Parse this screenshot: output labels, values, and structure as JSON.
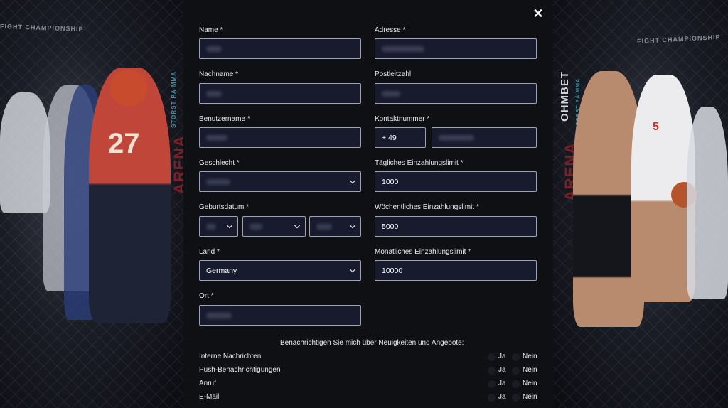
{
  "background": {
    "left_banner": "FIGHT CHAMPIONSHIP",
    "left_vertical_1": "ARENA",
    "left_vertical_2": "STORST PÅ MMA",
    "right_banner": "FIGHT CHAMPIONSHIP",
    "right_brand": "OHMBET",
    "right_vertical_1": "ARENA",
    "right_vertical_2": "STORST PÅ MMA",
    "jersey_left": "27",
    "jersey_right": "5"
  },
  "form": {
    "name": {
      "label": "Name *",
      "value": ""
    },
    "nachname": {
      "label": "Nachname *",
      "value": ""
    },
    "benutzername": {
      "label": "Benutzername *",
      "value": ""
    },
    "geschlecht": {
      "label": "Geschlecht *",
      "value": ""
    },
    "geburtsdatum": {
      "label": "Geburtsdatum *",
      "day": "",
      "month": "",
      "year": ""
    },
    "land": {
      "label": "Land *",
      "value": "Germany"
    },
    "ort": {
      "label": "Ort *",
      "value": ""
    },
    "adresse": {
      "label": "Adresse *",
      "value": ""
    },
    "postleitzahl": {
      "label": "Postleitzahl",
      "value": ""
    },
    "kontaktnummer": {
      "label": "Kontaktnummer *",
      "prefix": "+ 49",
      "value": ""
    },
    "daily_limit": {
      "label": "Tägliches Einzahlungslimit *",
      "value": "1000"
    },
    "weekly_limit": {
      "label": "Wöchentliches Einzahlungslimit *",
      "value": "5000"
    },
    "monthly_limit": {
      "label": "Monatliches Einzahlungslimit *",
      "value": "10000"
    }
  },
  "notifications": {
    "title": "Benachrichtigen Sie mich über Neuigkeiten und Angebote:",
    "yes_label": "Ja",
    "no_label": "Nein",
    "items": [
      {
        "label": "Interne Nachrichten"
      },
      {
        "label": "Push-Benachrichtigungen"
      },
      {
        "label": "Anruf"
      },
      {
        "label": "E-Mail"
      }
    ]
  },
  "close_icon": "close-icon",
  "colors": {
    "modal_bg": "#0f1014",
    "field_bg": "#181b2d",
    "field_border": "#9ea3b3",
    "accent": "#ffffff"
  }
}
